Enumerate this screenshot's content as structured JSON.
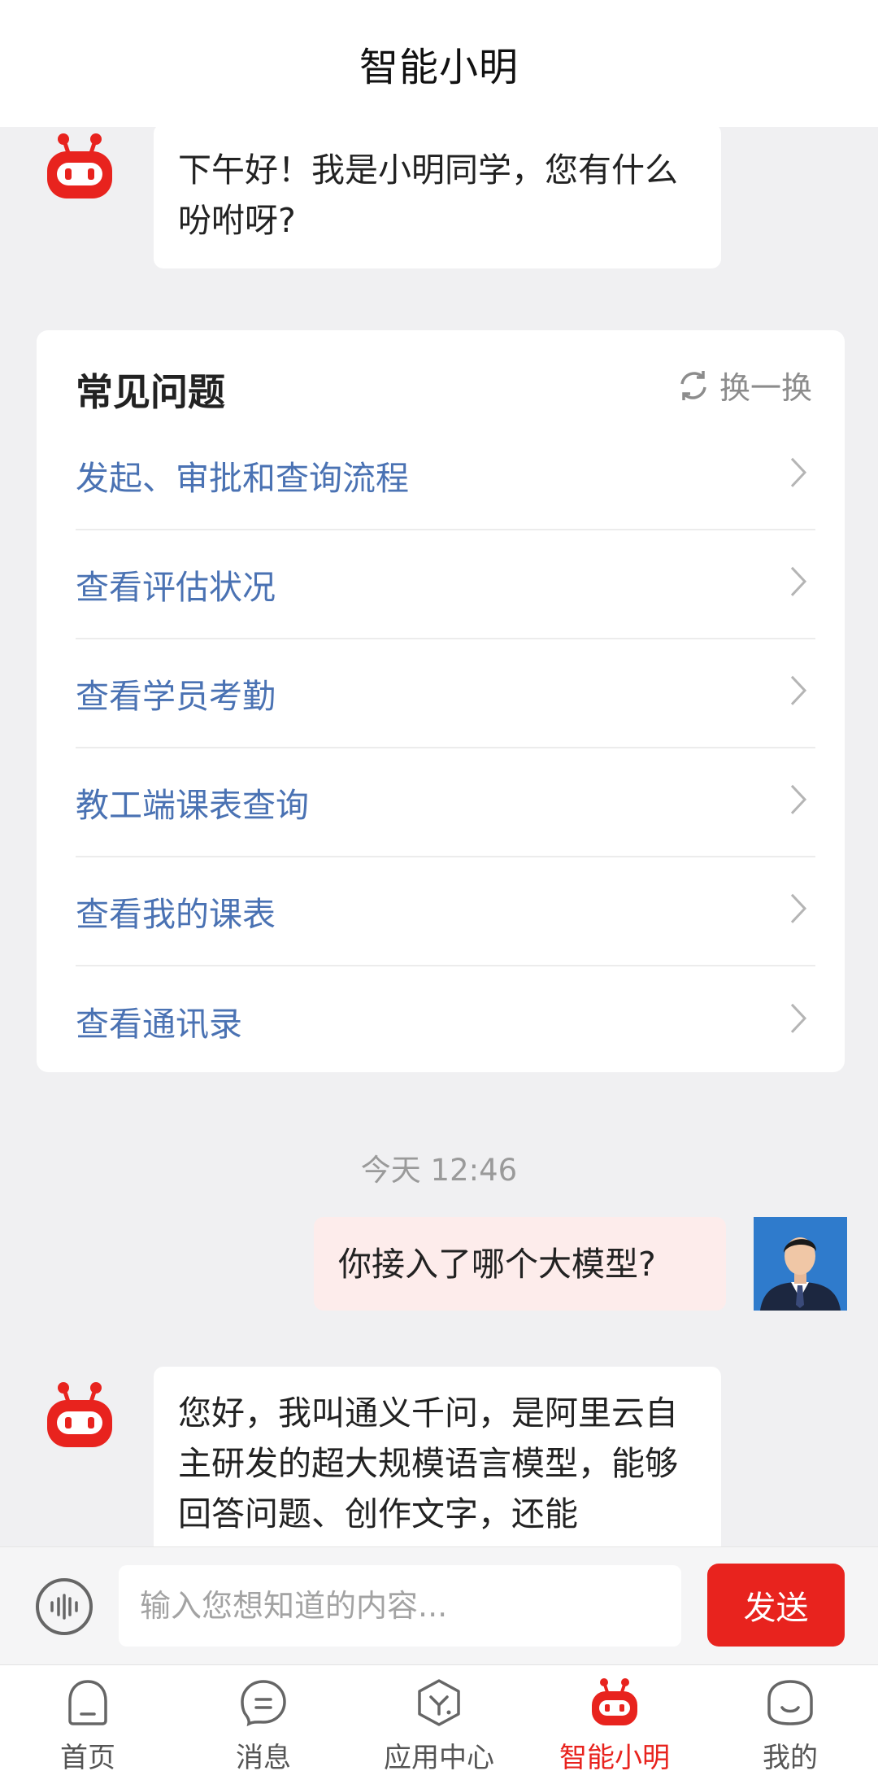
{
  "header": {
    "title": "智能小明"
  },
  "chat": {
    "greeting": "下午好！我是小明同学，您有什么吩咐呀?",
    "faq": {
      "title": "常见问题",
      "refresh_label": "换一换",
      "items": [
        {
          "label": "发起、审批和查询流程"
        },
        {
          "label": "查看评估状况"
        },
        {
          "label": "查看学员考勤"
        },
        {
          "label": "教工端课表查询"
        },
        {
          "label": "查看我的课表"
        },
        {
          "label": "查看通讯录"
        }
      ]
    },
    "timestamp": "今天 12:46",
    "user_message": "你接入了哪个大模型?",
    "bot_reply": "您好，我叫通义千问，是阿里云自主研发的超大规模语言模型，能够回答问题、创作文字，还能"
  },
  "input": {
    "placeholder": "输入您想知道的内容...",
    "value": "",
    "send_label": "发送"
  },
  "nav": {
    "items": [
      {
        "label": "首页",
        "icon": "home-icon"
      },
      {
        "label": "消息",
        "icon": "message-icon"
      },
      {
        "label": "应用中心",
        "icon": "app-center-icon"
      },
      {
        "label": "智能小明",
        "icon": "robot-icon",
        "active": true
      },
      {
        "label": "我的",
        "icon": "profile-icon"
      }
    ]
  },
  "colors": {
    "accent": "#e8231e",
    "link": "#4a72b3",
    "user_bubble": "#fdeceb"
  }
}
